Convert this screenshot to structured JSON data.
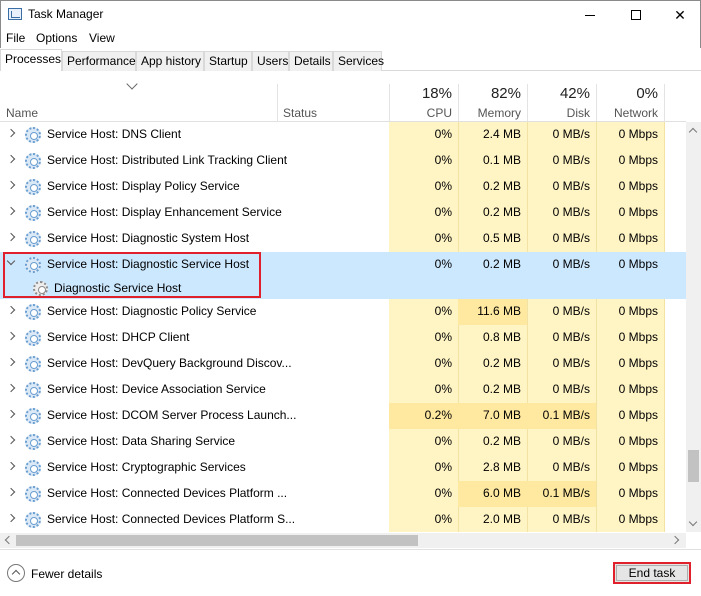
{
  "window": {
    "title": "Task Manager",
    "minimize": "",
    "maximize": "",
    "close": "✕"
  },
  "menu": [
    {
      "label": "File"
    },
    {
      "label": "Options"
    },
    {
      "label": "View"
    }
  ],
  "tabs": [
    {
      "label": "Processes",
      "active": true
    },
    {
      "label": "Performance"
    },
    {
      "label": "App history"
    },
    {
      "label": "Startup"
    },
    {
      "label": "Users"
    },
    {
      "label": "Details"
    },
    {
      "label": "Services"
    }
  ],
  "columns": {
    "name": "Name",
    "status": "Status",
    "cpu": {
      "label": "CPU",
      "percent": "18%"
    },
    "memory": {
      "label": "Memory",
      "percent": "82%"
    },
    "disk": {
      "label": "Disk",
      "percent": "42%"
    },
    "network": {
      "label": "Network",
      "percent": "0%"
    }
  },
  "rows": [
    {
      "name": "Service Host: DNS Client",
      "cpu": "0%",
      "memory": "2.4 MB",
      "disk": "0 MB/s",
      "network": "0 Mbps"
    },
    {
      "name": "Service Host: Distributed Link Tracking Client",
      "cpu": "0%",
      "memory": "0.1 MB",
      "disk": "0 MB/s",
      "network": "0 Mbps"
    },
    {
      "name": "Service Host: Display Policy Service",
      "cpu": "0%",
      "memory": "0.2 MB",
      "disk": "0 MB/s",
      "network": "0 Mbps"
    },
    {
      "name": "Service Host: Display Enhancement Service",
      "cpu": "0%",
      "memory": "0.2 MB",
      "disk": "0 MB/s",
      "network": "0 Mbps"
    },
    {
      "name": "Service Host: Diagnostic System Host",
      "cpu": "0%",
      "memory": "0.5 MB",
      "disk": "0 MB/s",
      "network": "0 Mbps"
    },
    {
      "name": "Service Host: Diagnostic Service Host",
      "cpu": "0%",
      "memory": "0.2 MB",
      "disk": "0 MB/s",
      "network": "0 Mbps",
      "expanded": true,
      "child": "Diagnostic Service Host"
    },
    {
      "name": "Service Host: Diagnostic Policy Service",
      "cpu": "0%",
      "memory": "11.6 MB",
      "disk": "0 MB/s",
      "network": "0 Mbps"
    },
    {
      "name": "Service Host: DHCP Client",
      "cpu": "0%",
      "memory": "0.8 MB",
      "disk": "0 MB/s",
      "network": "0 Mbps"
    },
    {
      "name": "Service Host: DevQuery Background Discov...",
      "cpu": "0%",
      "memory": "0.2 MB",
      "disk": "0 MB/s",
      "network": "0 Mbps"
    },
    {
      "name": "Service Host: Device Association Service",
      "cpu": "0%",
      "memory": "0.2 MB",
      "disk": "0 MB/s",
      "network": "0 Mbps"
    },
    {
      "name": "Service Host: DCOM Server Process Launch...",
      "cpu": "0.2%",
      "memory": "7.0 MB",
      "disk": "0.1 MB/s",
      "network": "0 Mbps"
    },
    {
      "name": "Service Host: Data Sharing Service",
      "cpu": "0%",
      "memory": "0.2 MB",
      "disk": "0 MB/s",
      "network": "0 Mbps"
    },
    {
      "name": "Service Host: Cryptographic Services",
      "cpu": "0%",
      "memory": "2.8 MB",
      "disk": "0 MB/s",
      "network": "0 Mbps"
    },
    {
      "name": "Service Host: Connected Devices Platform ...",
      "cpu": "0%",
      "memory": "6.0 MB",
      "disk": "0.1 MB/s",
      "network": "0 Mbps"
    },
    {
      "name": "Service Host: Connected Devices Platform S...",
      "cpu": "0%",
      "memory": "2.0 MB",
      "disk": "0 MB/s",
      "network": "0 Mbps"
    }
  ],
  "footer": {
    "fewer_details": "Fewer details",
    "end_task": "End task"
  },
  "colors": {
    "heat_light": "#fff4c4",
    "heat_medium": "#ffe9a0",
    "selection": "#cce8ff",
    "highlight": "#e0202a"
  }
}
